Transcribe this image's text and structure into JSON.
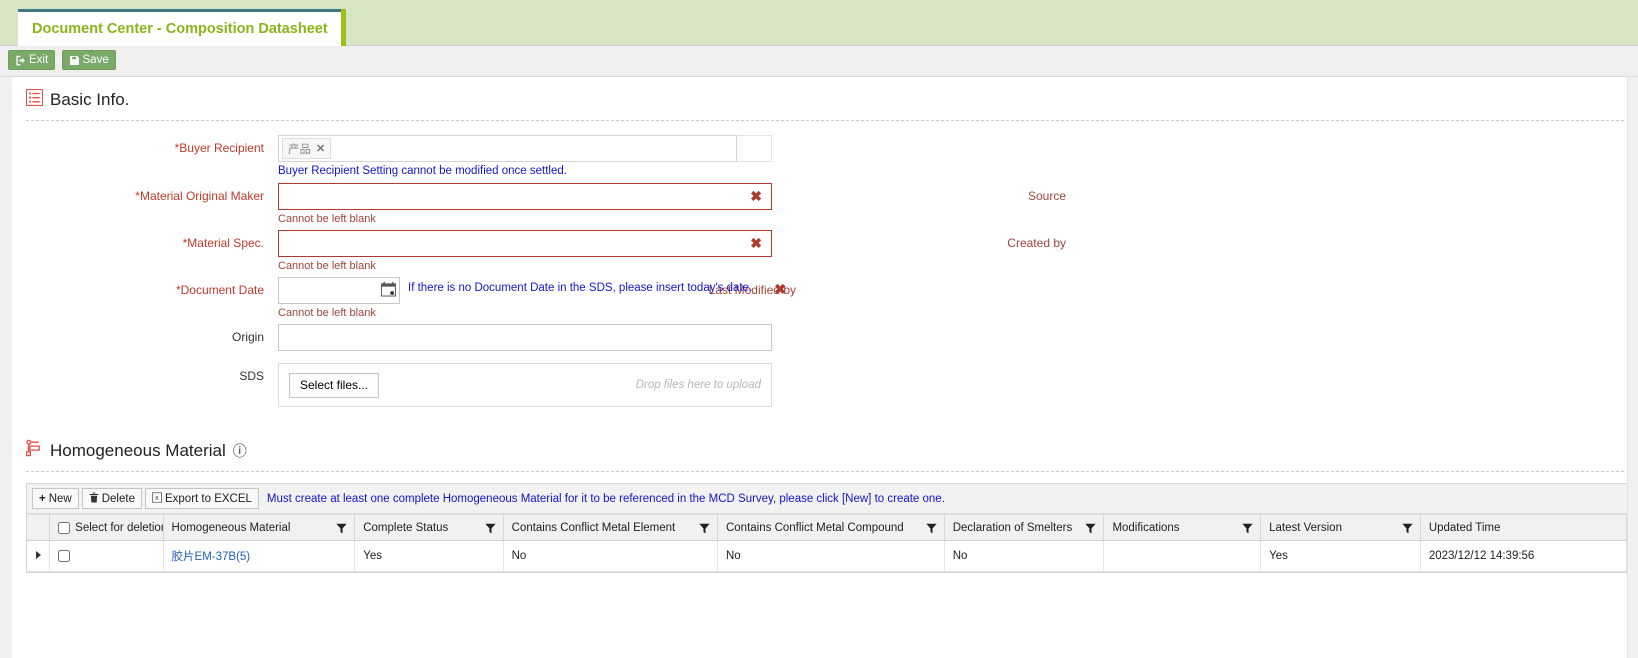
{
  "tab": {
    "label": "Document Center - Composition Datasheet"
  },
  "toolbar": {
    "exit_label": "Exit",
    "save_label": "Save"
  },
  "basic_info": {
    "title": "Basic Info.",
    "fields": {
      "buyer_recipient": {
        "label": "*Buyer Recipient",
        "chip": "产品",
        "chip_remove": "✕",
        "hint": "Buyer Recipient Setting cannot be modified once settled."
      },
      "material_original_maker": {
        "label": "*Material Original Maker",
        "value": "",
        "error": "Cannot be left blank",
        "side_label": "Source"
      },
      "material_spec": {
        "label": "*Material Spec.",
        "value": "",
        "error": "Cannot be left blank",
        "side_label": "Created by"
      },
      "document_date": {
        "label": "*Document Date",
        "value": "",
        "hint": "If there is no Document Date in the SDS, please insert today's date.",
        "error": "Cannot be left blank",
        "side_label": "Last Modified by"
      },
      "origin": {
        "label": "Origin",
        "value": ""
      },
      "sds": {
        "label": "SDS",
        "select_files_label": "Select files...",
        "drop_hint": "Drop files here to upload"
      }
    }
  },
  "homogeneous_material": {
    "title": "Homogeneous Material",
    "info_icon": "ⓘ",
    "toolbar": {
      "new_label": "New",
      "delete_label": "Delete",
      "export_label": "Export to EXCEL",
      "note": "Must create at least one complete Homogeneous Material for it to be referenced in the MCD Survey, please click [New] to create one."
    },
    "grid": {
      "select_for_deletion_label": "Select for deletion",
      "columns": [
        "Homogeneous Material",
        "Complete Status",
        "Contains Conflict Metal Element",
        "Contains Conflict Metal Compound",
        "Declaration of Smelters",
        "Modifications",
        "Latest Version",
        "Updated Time"
      ],
      "rows": [
        {
          "material": "胶片EM-37B(5)",
          "complete_status": "Yes",
          "contains_conflict_metal_element": "No",
          "contains_conflict_metal_compound": "No",
          "declaration_of_smelters": "No",
          "modifications": "",
          "latest_version": "Yes",
          "updated_time": "2023/12/12 14:39:56"
        }
      ]
    }
  },
  "colors": {
    "tab_text": "#8ab51a",
    "tab_top_border": "#3d7a86",
    "tab_accent": "#9cc017",
    "tabstrip_bg": "#d6e6c4",
    "button_green": "#7aa96a",
    "error_red": "#b03a2e",
    "hint_blue": "#1414cf",
    "side_label_red": "#a0453a",
    "link_blue": "#2060c0",
    "section_icon_red": "#e8524a"
  }
}
